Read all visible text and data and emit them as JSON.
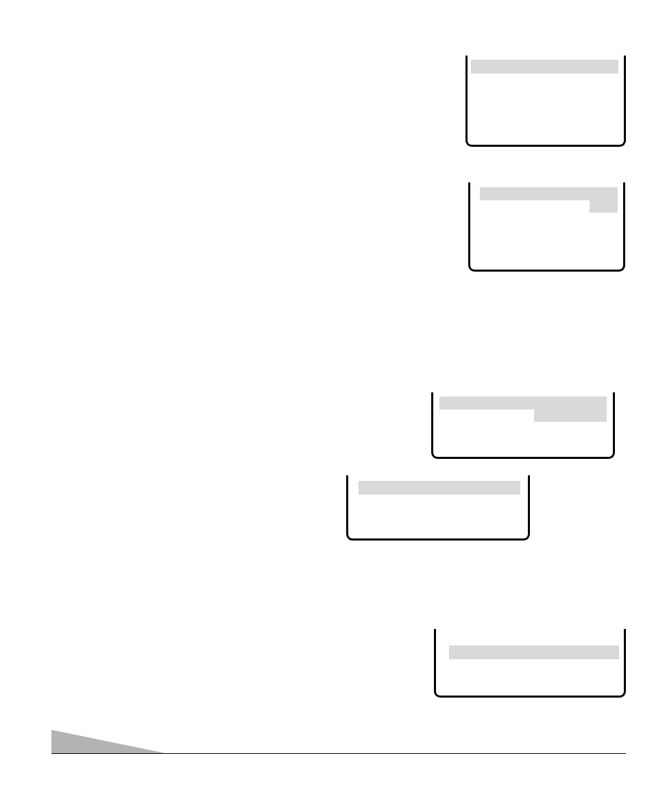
{
  "screens": [
    {
      "kind": "single"
    },
    {
      "kind": "wrapped"
    },
    {
      "kind": "wrapped"
    },
    {
      "kind": "single"
    },
    {
      "kind": "single"
    }
  ]
}
